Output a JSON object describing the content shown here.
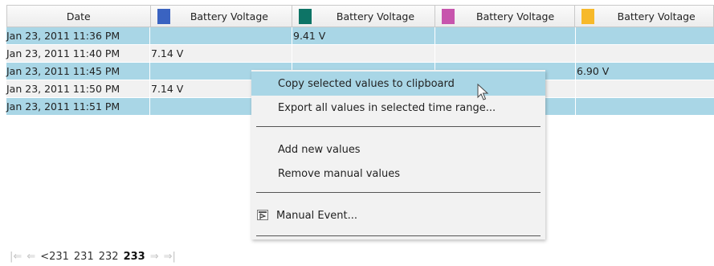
{
  "table": {
    "headers": [
      {
        "label": "Date",
        "color": ""
      },
      {
        "label": "Battery Voltage",
        "color": "#3a63c1"
      },
      {
        "label": "Battery Voltage",
        "color": "#0d7466"
      },
      {
        "label": "Battery Voltage",
        "color": "#c755ad"
      },
      {
        "label": "Battery Voltage",
        "color": "#f7b92a"
      }
    ],
    "rows": [
      {
        "date": "Jan 23, 2011 11:36 PM",
        "v1": "",
        "v2": "9.41 V",
        "v3": "",
        "v4": ""
      },
      {
        "date": "Jan 23, 2011 11:40 PM",
        "v1": "7.14 V",
        "v2": "",
        "v3": "",
        "v4": ""
      },
      {
        "date": "Jan 23, 2011 11:45 PM",
        "v1": "",
        "v2": "",
        "v3": "",
        "v4": "6.90 V"
      },
      {
        "date": "Jan 23, 2011 11:50 PM",
        "v1": "7.14 V",
        "v2": "",
        "v3": "",
        "v4": ""
      },
      {
        "date": "Jan 23, 2011 11:51 PM",
        "v1": "",
        "v2": "",
        "v3": "",
        "v4": ""
      }
    ]
  },
  "context_menu": {
    "copy": "Copy selected values to clipboard",
    "export": "Export all values in selected time range...",
    "add": "Add new values",
    "remove": "Remove manual values",
    "manual_event": "Manual Event...",
    "manual_event_icon": "event-flag-icon"
  },
  "pager": {
    "first_icon": "first-page-icon",
    "prev_icon": "previous-page-icon",
    "prev_label": "<231",
    "pages": [
      "231",
      "232"
    ],
    "current": "233",
    "next_icon": "next-page-icon",
    "last_icon": "last-page-icon"
  },
  "colors": {
    "selection": "#a9d6e6",
    "alt_row": "#f1f1f1"
  }
}
